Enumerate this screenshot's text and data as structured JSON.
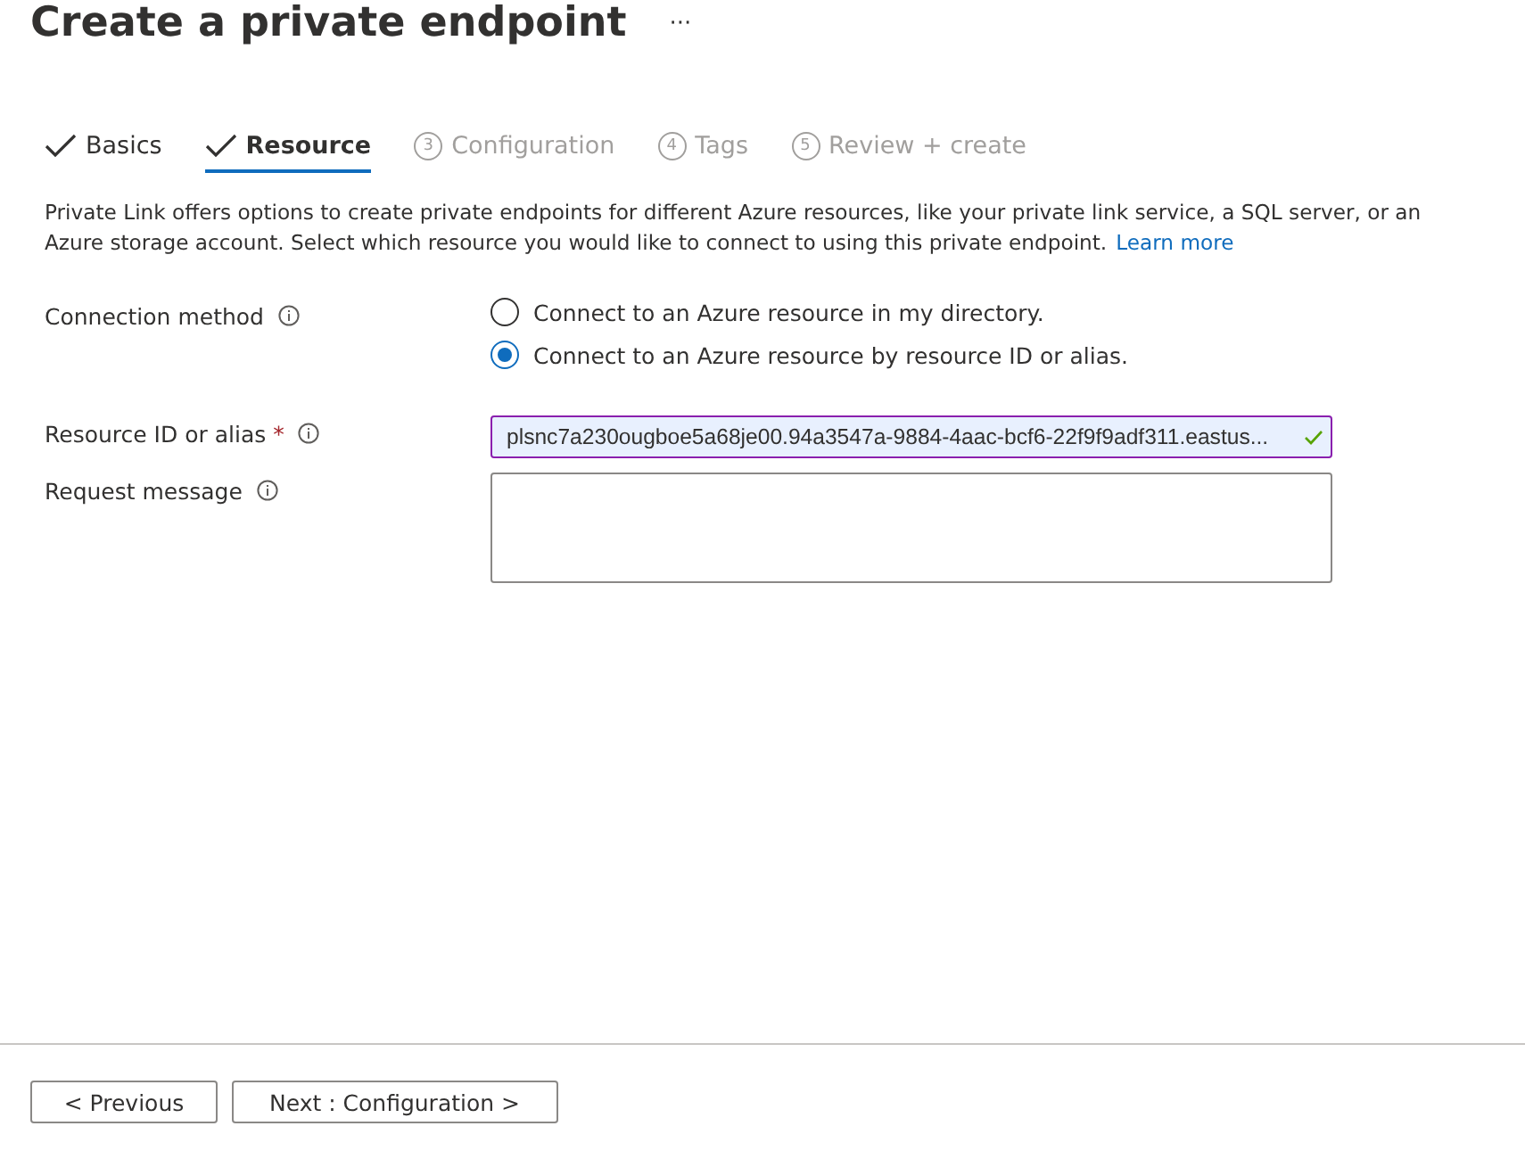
{
  "header": {
    "title": "Create a private endpoint",
    "more": "···"
  },
  "tabs": [
    {
      "label": "Basics",
      "selected": false,
      "completed": true
    },
    {
      "label": "Resource",
      "selected": true,
      "completed": true
    },
    {
      "label": "Configuration",
      "selected": false,
      "completed": false,
      "number": "3"
    },
    {
      "label": "Tags",
      "selected": false,
      "completed": false,
      "number": "4"
    },
    {
      "label": "Review + create",
      "selected": false,
      "completed": false,
      "number": "5"
    }
  ],
  "description": {
    "text": "Private Link offers options to create private endpoints for different Azure resources, like your private link service, a SQL server, or an Azure storage account. Select which resource you would like to connect to using this private endpoint.",
    "link": "Learn more"
  },
  "connection_method": {
    "label": "Connection method",
    "options": [
      {
        "label": "Connect to an Azure resource in my directory.",
        "selected": false
      },
      {
        "label": "Connect to an Azure resource by resource ID or alias.",
        "selected": true
      }
    ]
  },
  "resource_id": {
    "label": "Resource ID or alias",
    "required_mark": "*",
    "value": "plsnc7a230ougboe5a68je00.94a3547a-9884-4aac-bcf6-22f9f9adf311.eastus...",
    "valid": true
  },
  "request_message": {
    "label": "Request message"
  },
  "footer": {
    "buttons": [
      "< Previous",
      "Next : Configuration >"
    ]
  }
}
